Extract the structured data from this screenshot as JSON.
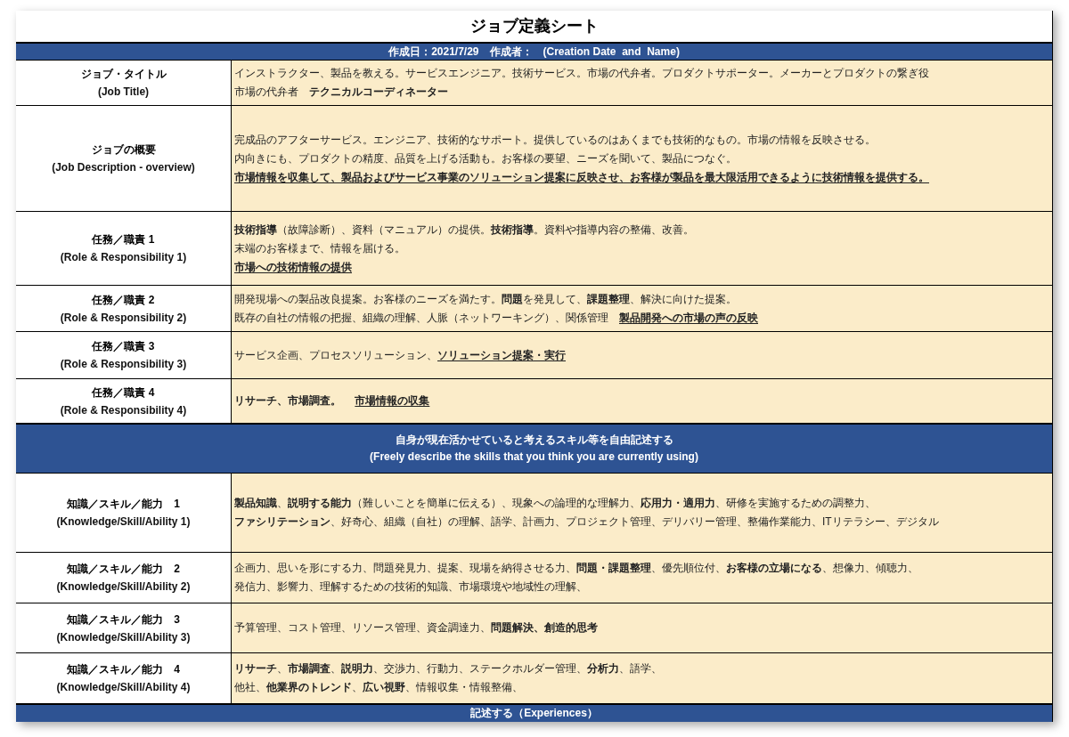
{
  "title": "ジョブ定義シート",
  "rows": [
    {
      "kind": "band",
      "lines": [
        "作成日：2021/7/29　作成者：　(Creation Date  and  Name)"
      ]
    },
    {
      "kind": "field",
      "label": "ジョブ・タイトル",
      "label_en": "(Job Title)",
      "lines": [
        [
          {
            "text": "インストラクター、製品を教える。サービスエンジニア。技術サービス。市場の代弁者。プロダクトサポーター。メーカーとプロダクトの繋ぎ役",
            "kind": "plain"
          }
        ],
        [
          {
            "text": "市場の代弁者　",
            "kind": "plain"
          },
          {
            "text": "テクニカルコーディネーター",
            "kind": "bold"
          }
        ]
      ]
    },
    {
      "kind": "field",
      "label": "ジョブの概要",
      "label_en": "(Job Description - overview)",
      "lines": [
        [
          {
            "text": "完成品のアフターサービス。エンジニア、技術的なサポート。提供しているのはあくまでも技術的なもの。市場の情報を反映させる。",
            "kind": "plain"
          }
        ],
        [
          {
            "text": "内向きにも、プロダクトの精度、品質を上げる活動も。お客様の要望、ニーズを聞いて、製品につなぐ。",
            "kind": "plain"
          }
        ],
        [
          {
            "text": "市場情報を収集して、製品およびサービス事業のソリューション提案に反映させ、お客様が製品を最大限活用できるように技術情報を提供する。",
            "kind": "underlined"
          }
        ]
      ]
    },
    {
      "kind": "field",
      "label": "任務／職責 1",
      "label_en": "(Role & Responsibility 1)",
      "lines": [
        [
          {
            "text": "技術指導",
            "kind": "bold"
          },
          {
            "text": "（故障診断）、資料（マニュアル）の提供。",
            "kind": "plain"
          },
          {
            "text": "技術指導",
            "kind": "bold"
          },
          {
            "text": "。資料や指導内容の整備、改善。",
            "kind": "plain"
          }
        ],
        [
          {
            "text": "末端のお客様まで、情報を届ける。",
            "kind": "plain"
          }
        ],
        [
          {
            "text": "市場への技術情報の提供",
            "kind": "underlined"
          }
        ]
      ]
    },
    {
      "kind": "field",
      "label": "任務／職責 2",
      "label_en": "(Role & Responsibility 2)",
      "lines": [
        [
          {
            "text": "開発現場への製品改良提案。お客様のニーズを満たす。",
            "kind": "plain"
          },
          {
            "text": "問題",
            "kind": "bold"
          },
          {
            "text": "を発見して、",
            "kind": "plain"
          },
          {
            "text": "課題整理",
            "kind": "bold"
          },
          {
            "text": "、解決に向けた提案。",
            "kind": "plain"
          }
        ],
        [
          {
            "text": "既存の自社の情報の把握、組織の理解、人脈（ネットワーキング）、関係管理　",
            "kind": "plain"
          },
          {
            "text": "製品開発への市場の声の反映",
            "kind": "underlined"
          }
        ]
      ]
    },
    {
      "kind": "field",
      "label": "任務／職責 3",
      "label_en": "(Role & Responsibility 3)",
      "lines": [
        [
          {
            "text": "サービス企画、プロセスソリューション、",
            "kind": "plain"
          },
          {
            "text": "ソリューション提案・実行",
            "kind": "underlined"
          }
        ]
      ]
    },
    {
      "kind": "field",
      "label": "任務／職責 4",
      "label_en": "(Role & Responsibility 4)",
      "lines": [
        [
          {
            "text": "リサーチ、市場調査。　 ",
            "kind": "bold"
          },
          {
            "text": "市場情報の収集",
            "kind": "underlined"
          }
        ]
      ]
    },
    {
      "kind": "band",
      "lines": [
        "自身が現在活かせていると考えるスキル等を自由記述する",
        "(Freely describe the skills that you think you are currently using)"
      ]
    },
    {
      "kind": "field",
      "label": "知識／スキル／能力　1",
      "label_en": "(Knowledge/Skill/Ability 1)",
      "lines": [
        [
          {
            "text": "製品知識",
            "kind": "bold"
          },
          {
            "text": "、",
            "kind": "plain"
          },
          {
            "text": "説明する能力",
            "kind": "bold"
          },
          {
            "text": "（難しいことを簡単に伝える）、現象への論理的な理解力、",
            "kind": "plain"
          },
          {
            "text": "応用力・適用力",
            "kind": "bold"
          },
          {
            "text": "、研修を実施するための調整力、",
            "kind": "plain"
          }
        ],
        [
          {
            "text": "ファシリテーション",
            "kind": "bold"
          },
          {
            "text": "、好奇心、組織（自社）の理解、語学、計画力、プロジェクト管理、デリバリー管理、整備作業能力、ITリテラシー、デジタル",
            "kind": "plain"
          }
        ]
      ]
    },
    {
      "kind": "field",
      "label": "知識／スキル／能力　2",
      "label_en": "(Knowledge/Skill/Ability 2)",
      "lines": [
        [
          {
            "text": "企画力、思いを形にする力、問題発見力、提案、現場を納得させる力、",
            "kind": "plain"
          },
          {
            "text": "問題・課題整理",
            "kind": "bold"
          },
          {
            "text": "、優先順位付、",
            "kind": "plain"
          },
          {
            "text": "お客様の立場になる",
            "kind": "bold"
          },
          {
            "text": "、想像力、傾聴力、",
            "kind": "plain"
          }
        ],
        [
          {
            "text": "発信力、影響力、理解するための技術的知識、市場環境や地域性の理解、",
            "kind": "plain"
          }
        ]
      ]
    },
    {
      "kind": "field",
      "label": "知識／スキル／能力　3",
      "label_en": "(Knowledge/Skill/Ability 3)",
      "lines": [
        [
          {
            "text": "予算管理、コスト管理、リソース管理、資金調達力、",
            "kind": "plain"
          },
          {
            "text": "問題解決、創造的思考",
            "kind": "bold"
          }
        ]
      ]
    },
    {
      "kind": "field",
      "label": "知識／スキル／能力　4",
      "label_en": "(Knowledge/Skill/Ability 4)",
      "lines": [
        [
          {
            "text": "リサーチ",
            "kind": "bold"
          },
          {
            "text": "、",
            "kind": "plain"
          },
          {
            "text": "市場調査",
            "kind": "bold"
          },
          {
            "text": "、",
            "kind": "plain"
          },
          {
            "text": "説明力",
            "kind": "bold"
          },
          {
            "text": "、交渉力、行動力、ステークホルダー管理、",
            "kind": "plain"
          },
          {
            "text": "分析力",
            "kind": "bold"
          },
          {
            "text": "、語学、",
            "kind": "plain"
          }
        ],
        [
          {
            "text": "他社、",
            "kind": "plain"
          },
          {
            "text": "他業界のトレンド",
            "kind": "bold"
          },
          {
            "text": "、",
            "kind": "plain"
          },
          {
            "text": "広い視野",
            "kind": "bold"
          },
          {
            "text": "、情報収集・情報整備、",
            "kind": "plain"
          }
        ]
      ]
    },
    {
      "kind": "band",
      "lines": [
        "記述する（Experiences）"
      ]
    }
  ]
}
